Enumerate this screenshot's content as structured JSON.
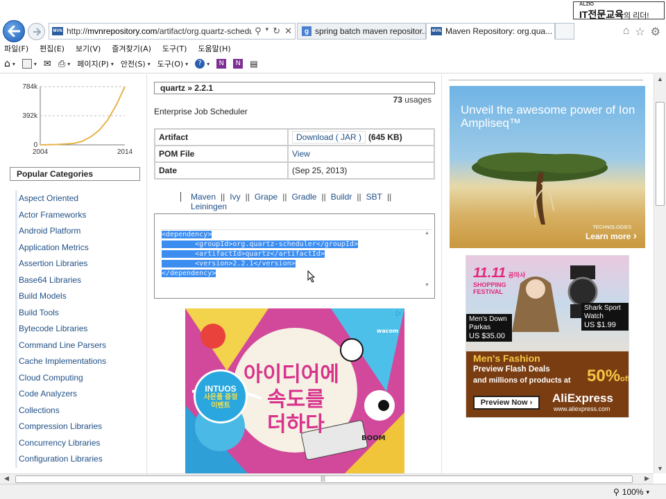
{
  "browser": {
    "brand_small": "ALZIO",
    "brand_big": "IT전문교육",
    "brand_suffix": "의 리더!",
    "url_prefix": "http://",
    "url_host": "mvnrepository.com",
    "url_path": "/artifact/org.quartz-schedu",
    "tabs": [
      {
        "label": "spring batch maven repositor...",
        "icon": "google-icon"
      },
      {
        "label": "Maven Repository: org.qua...",
        "icon": "mvn-favicon"
      }
    ],
    "menu": [
      "파일(F)",
      "편집(E)",
      "보기(V)",
      "즐겨찾기(A)",
      "도구(T)",
      "도움말(H)"
    ],
    "toolbar": {
      "page": "페이지(P)",
      "safety": "안전(S)",
      "tools": "도구(O)"
    },
    "zoom": "100%"
  },
  "mini_chart": {
    "chart_data": {
      "type": "area",
      "x_ticks": [
        "2004",
        "2014"
      ],
      "y_ticks": [
        "784k",
        "392k",
        "0"
      ],
      "ylim": [
        0,
        784000
      ],
      "xlim": [
        2004,
        2014
      ],
      "series": [
        {
          "values_x": [
            2004,
            2006,
            2008,
            2009,
            2010,
            2011,
            2012,
            2013,
            2014
          ],
          "values_y": [
            0,
            5000,
            20000,
            50000,
            110000,
            200000,
            340000,
            540000,
            784000
          ]
        }
      ],
      "color": "#e6b34a"
    }
  },
  "sidebar": {
    "title": "Popular Categories",
    "categories": [
      "Aspect Oriented",
      "Actor Frameworks",
      "Android Platform",
      "Application Metrics",
      "Assertion Libraries",
      "Base64 Libraries",
      "Build Models",
      "Build Tools",
      "Bytecode Libraries",
      "Command Line Parsers",
      "Cache Implementations",
      "Cloud Computing",
      "Code Analyzers",
      "Collections",
      "Compression Libraries",
      "Concurrency Libraries",
      "Configuration Libraries"
    ]
  },
  "artifact": {
    "breadcrumb": "quartz » 2.2.1",
    "usages_count": "73",
    "usages_label": "usages",
    "description": "Enterprise Job Scheduler",
    "rows": {
      "artifact_label": "Artifact",
      "download_label": "Download ( JAR )",
      "size": "(645 KB)",
      "pom_label": "POM File",
      "pom_link": "View",
      "date_label": "Date",
      "date_value": "(Sep 25, 2013)"
    },
    "build_tools": [
      "Maven",
      "Ivy",
      "Grape",
      "Gradle",
      "Buildr",
      "SBT",
      "Leiningen"
    ],
    "snippet": [
      "<dependency>",
      "        <groupId>org.quartz-scheduler</groupId>",
      "        <artifactId>quartz</artifactId>",
      "        <version>2.2.1</version>",
      "</dependency>"
    ]
  },
  "ads": {
    "wacom": {
      "brand": "wacom",
      "line1": "아이디어에",
      "line2": "속도를",
      "line3": "더하다",
      "badge": "INTUOS",
      "badge_sub": "사은품 증정 이벤트",
      "comic": "BOOM"
    },
    "ion": {
      "headline": "Unveil the awesome power of Ion Ampliseq™",
      "more": "Learn more",
      "brand": "TECHNOLOGIES"
    },
    "ali": {
      "festival": "11.11",
      "festival_sub": "SHOPPING FESTIVAL",
      "festival_tag": "공마사",
      "item1_name": "Men's Down Parkas",
      "item1_price": "US $35.00",
      "item2_name": "Shark Sport Watch",
      "item2_price": "US $1.99",
      "title": "Men's Fashion",
      "sub1": "Preview Flash Deals",
      "sub2": "and millions of products at",
      "discount": "50%",
      "discount_off": "off",
      "cta": "Preview Now ›",
      "logo": "AliExpress",
      "url": "www.aliexpress.com"
    }
  }
}
